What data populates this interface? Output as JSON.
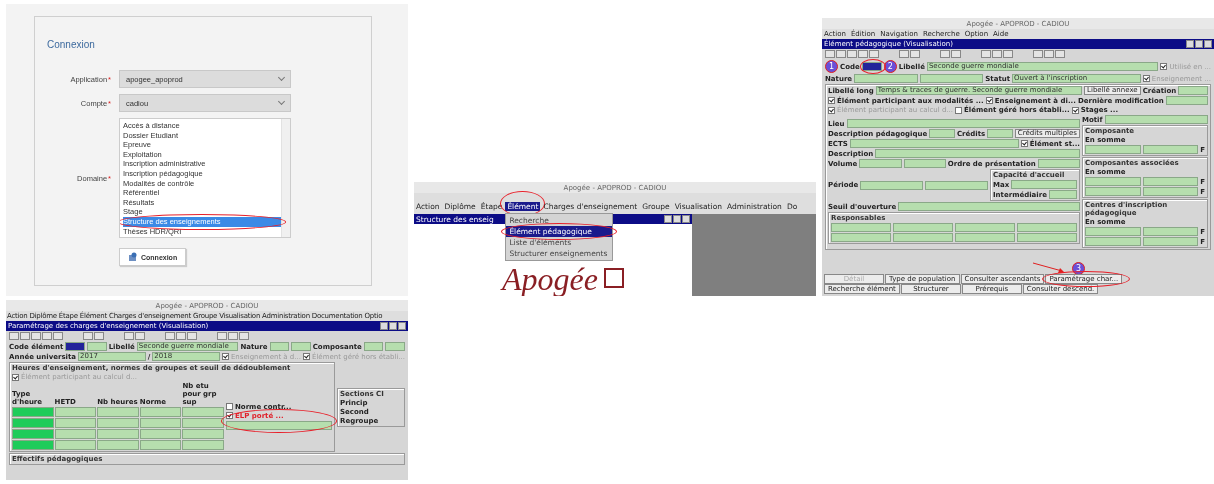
{
  "login": {
    "title": "Connexion",
    "selects": [
      {
        "label": "Application",
        "required": "*",
        "value": "apogee_apoprod"
      },
      {
        "label": "Compte",
        "required": "*",
        "value": "cadiou"
      }
    ],
    "domain": {
      "label": "Domaine",
      "required": "*",
      "options": [
        {
          "label": "Accès à distance",
          "selected": false,
          "circled": false
        },
        {
          "label": "Dossier Etudiant",
          "selected": false,
          "circled": false
        },
        {
          "label": "Epreuve",
          "selected": false,
          "circled": false
        },
        {
          "label": "Exploitation",
          "selected": false,
          "circled": false
        },
        {
          "label": "Inscription administrative",
          "selected": false,
          "circled": false
        },
        {
          "label": "Inscription pédagogique",
          "selected": false,
          "circled": false
        },
        {
          "label": "Modalités de contrôle",
          "selected": false,
          "circled": false
        },
        {
          "label": "Référentiel",
          "selected": false,
          "circled": false
        },
        {
          "label": "Résultats",
          "selected": false,
          "circled": false
        },
        {
          "label": "Stage",
          "selected": false,
          "circled": false
        },
        {
          "label": "Structure des enseignements",
          "selected": true,
          "circled": true
        },
        {
          "label": "Thèses HDR/QRI",
          "selected": false,
          "circled": false
        }
      ]
    },
    "button": "Connexion"
  },
  "menu_screen": {
    "title": "Apogée - APOPROD - CADIOU",
    "menu": [
      {
        "label": "Action",
        "open": false
      },
      {
        "label": "Diplôme",
        "open": false
      },
      {
        "label": "Étape",
        "open": false
      },
      {
        "label": "Élément",
        "open": true
      },
      {
        "label": "Charges d'enseignement",
        "open": false
      },
      {
        "label": "Groupe",
        "open": false
      },
      {
        "label": "Visualisation",
        "open": false
      },
      {
        "label": "Administration",
        "open": false
      },
      {
        "label": "Do",
        "open": false
      }
    ],
    "dropdown": [
      {
        "label": "Recherche",
        "selected": false
      },
      {
        "label": "Élément pédagogique",
        "selected": true
      },
      {
        "label": "Liste d'éléments",
        "selected": false
      },
      {
        "label": "Structurer enseignements",
        "selected": false
      }
    ],
    "child_window": "Structure des enseig",
    "logo": "Apogée"
  },
  "element_screen": {
    "title": "Apogée - APOPROD - CADIOU",
    "menu": [
      "Action",
      "Édition",
      "Navigation",
      "Recherche",
      "Option",
      "Aide"
    ],
    "window_title": "Élément pédagogique (Visualisation)",
    "rows": [
      {
        "items": [
          {
            "kind": "note",
            "text": "1"
          },
          {
            "kind": "label",
            "text": "Code"
          },
          {
            "kind": "field",
            "focused": true,
            "circled": true
          },
          {
            "kind": "note",
            "text": "2"
          },
          {
            "kind": "label",
            "text": "Libellé"
          },
          {
            "kind": "field",
            "value": "Seconde guerre mondiale"
          },
          {
            "kind": "check",
            "label": "Utilisé en ...",
            "checked": true,
            "disabled": true
          }
        ]
      },
      {
        "items": [
          {
            "kind": "label",
            "text": "Nature"
          },
          {
            "kind": "field"
          },
          {
            "kind": "field"
          },
          {
            "kind": "label",
            "text": "Statut"
          },
          {
            "kind": "field",
            "value": "Ouvert à l'inscription"
          },
          {
            "kind": "check",
            "label": "Enseignement ...",
            "checked": true,
            "disabled": true
          }
        ]
      },
      {
        "items": [
          {
            "kind": "group",
            "rows": [
              {
                "items": [
                  {
                    "kind": "label",
                    "text": "Libellé long"
                  },
                  {
                    "kind": "field",
                    "value": "Temps & traces de guerre. Seconde guerre mondiale"
                  },
                  {
                    "kind": "button",
                    "label": "Libellé annexe"
                  },
                  {
                    "kind": "label",
                    "text": "Création"
                  },
                  {
                    "kind": "field"
                  }
                ]
              },
              {
                "items": [
                  {
                    "kind": "check",
                    "label": "Élément participant aux modalités ...",
                    "checked": true
                  },
                  {
                    "kind": "check",
                    "label": "Enseignement à di...",
                    "checked": true
                  },
                  {
                    "kind": "label",
                    "text": "Dernière modification"
                  },
                  {
                    "kind": "field"
                  }
                ]
              },
              {
                "items": [
                  {
                    "kind": "check",
                    "label": "Élément participant au calcul d...",
                    "checked": true,
                    "disabled": true
                  },
                  {
                    "kind": "check",
                    "label": "Élément géré hors établi...",
                    "checked": false
                  },
                  {
                    "kind": "check",
                    "label": "Stages ...",
                    "checked": true
                  }
                ]
              },
              {
                "items": [
                  {
                    "kind": "column",
                    "rows": [
                      {
                        "items": [
                          {
                            "kind": "label",
                            "text": "Lieu"
                          },
                          {
                            "kind": "field"
                          }
                        ]
                      },
                      {
                        "items": [
                          {
                            "kind": "label",
                            "text": "Description pédagogique"
                          },
                          {
                            "kind": "field"
                          },
                          {
                            "kind": "label",
                            "text": "Crédits"
                          },
                          {
                            "kind": "field"
                          },
                          {
                            "kind": "button",
                            "label": "Crédits multiples"
                          }
                        ]
                      },
                      {
                        "items": [
                          {
                            "kind": "label",
                            "text": "ECTS"
                          },
                          {
                            "kind": "field"
                          },
                          {
                            "kind": "check",
                            "label": "Élément st...",
                            "checked": true
                          }
                        ]
                      },
                      {
                        "items": [
                          {
                            "kind": "label",
                            "text": "Description"
                          },
                          {
                            "kind": "field"
                          }
                        ]
                      },
                      {
                        "items": [
                          {
                            "kind": "label",
                            "text": "Volume"
                          },
                          {
                            "kind": "field"
                          },
                          {
                            "kind": "field"
                          },
                          {
                            "kind": "label",
                            "text": "Ordre de présentation"
                          },
                          {
                            "kind": "field"
                          }
                        ]
                      },
                      {
                        "items": [
                          {
                            "kind": "label",
                            "text": "Période"
                          },
                          {
                            "kind": "field"
                          },
                          {
                            "kind": "field"
                          },
                          {
                            "kind": "group",
                            "title": "Capacité d'accueil",
                            "rows": [
                              {
                                "items": [
                                  {
                                    "kind": "label",
                                    "text": "Max"
                                  },
                                  {
                                    "kind": "field"
                                  }
                                ]
                              },
                              {
                                "items": [
                                  {
                                    "kind": "label",
                                    "text": "Intermédiaire"
                                  },
                                  {
                                    "kind": "field"
                                  }
                                ]
                              }
                            ]
                          }
                        ]
                      },
                      {
                        "items": [
                          {
                            "kind": "label",
                            "text": "Seuil d'ouverture"
                          },
                          {
                            "kind": "field"
                          }
                        ]
                      },
                      {
                        "items": [
                          {
                            "kind": "group",
                            "title": "Responsables",
                            "rows": [
                              {
                                "items": [
                                  {
                                    "kind": "field"
                                  },
                                  {
                                    "kind": "field"
                                  },
                                  {
                                    "kind": "field"
                                  },
                                  {
                                    "kind": "field"
                                  }
                                ]
                              },
                              {
                                "items": [
                                  {
                                    "kind": "field"
                                  },
                                  {
                                    "kind": "field"
                                  },
                                  {
                                    "kind": "field"
                                  },
                                  {
                                    "kind": "field"
                                  }
                                ]
                              }
                            ]
                          }
                        ]
                      }
                    ]
                  },
                  {
                    "kind": "column",
                    "rows": [
                      {
                        "items": [
                          {
                            "kind": "label",
                            "text": "Motif"
                          },
                          {
                            "kind": "field"
                          }
                        ]
                      },
                      {
                        "items": [
                          {
                            "kind": "group",
                            "title": "Composante",
                            "rows": [
                              {
                                "items": [
                                  {
                                    "kind": "label",
                                    "text": "En somme"
                                  }
                                ]
                              },
                              {
                                "items": [
                                  {
                                    "kind": "field"
                                  },
                                  {
                                    "kind": "field"
                                  },
                                  {
                                    "kind": "label",
                                    "text": "F"
                                  }
                                ]
                              }
                            ]
                          }
                        ]
                      },
                      {
                        "items": [
                          {
                            "kind": "group",
                            "title": "Composantes associées",
                            "rows": [
                              {
                                "items": [
                                  {
                                    "kind": "label",
                                    "text": "En somme"
                                  }
                                ]
                              },
                              {
                                "items": [
                                  {
                                    "kind": "field"
                                  },
                                  {
                                    "kind": "field"
                                  },
                                  {
                                    "kind": "label",
                                    "text": "F"
                                  }
                                ]
                              },
                              {
                                "items": [
                                  {
                                    "kind": "field"
                                  },
                                  {
                                    "kind": "field"
                                  },
                                  {
                                    "kind": "label",
                                    "text": "F"
                                  }
                                ]
                              }
                            ]
                          }
                        ]
                      },
                      {
                        "items": [
                          {
                            "kind": "group",
                            "title": "Centres d'inscription pédagogique",
                            "rows": [
                              {
                                "items": [
                                  {
                                    "kind": "label",
                                    "text": "En somme"
                                  }
                                ]
                              },
                              {
                                "items": [
                                  {
                                    "kind": "field"
                                  },
                                  {
                                    "kind": "field"
                                  },
                                  {
                                    "kind": "label",
                                    "text": "F"
                                  }
                                ]
                              },
                              {
                                "items": [
                                  {
                                    "kind": "field"
                                  },
                                  {
                                    "kind": "field"
                                  },
                                  {
                                    "kind": "label",
                                    "text": "F"
                                  }
                                ]
                              }
                            ]
                          }
                        ]
                      }
                    ]
                  }
                ]
              }
            ]
          }
        ]
      }
    ],
    "buttons": [
      [
        {
          "label": "Détail",
          "disabled": true,
          "circled": false
        },
        {
          "label": "Type de population",
          "disabled": false,
          "circled": false
        },
        {
          "label": "Consulter ascendants",
          "disabled": false,
          "circled": false
        },
        {
          "label": "Paramétrage char...",
          "disabled": false,
          "circled": true
        }
      ],
      [
        {
          "label": "Recherche élément",
          "disabled": false,
          "circled": false
        },
        {
          "label": "Structurer",
          "disabled": false,
          "circled": false
        },
        {
          "label": "Prérequis",
          "disabled": false,
          "circled": false
        },
        {
          "label": "Consulter descend.",
          "disabled": false,
          "circled": false
        }
      ]
    ],
    "step": "3"
  },
  "charges_screen": {
    "title": "Apogée - APOPROD - CADIOU",
    "menu": [
      "Action",
      "Diplôme",
      "Étape",
      "Élément",
      "Charges d'enseignement",
      "Groupe",
      "Visualisation",
      "Administration",
      "Documentation",
      "Optio"
    ],
    "window_title": "Paramétrage des charges d'enseignement (Visualisation)",
    "rows": [
      {
        "items": [
          {
            "kind": "label",
            "text": "Code élément"
          },
          {
            "kind": "field",
            "focused": true
          },
          {
            "kind": "field"
          },
          {
            "kind": "label",
            "text": "Libellé"
          },
          {
            "kind": "field",
            "value": "Seconde guerre mondiale"
          },
          {
            "kind": "label",
            "text": "Nature"
          },
          {
            "kind": "field"
          },
          {
            "kind": "field"
          },
          {
            "kind": "label",
            "text": "Composante"
          },
          {
            "kind": "field"
          },
          {
            "kind": "field"
          }
        ]
      },
      {
        "items": [
          {
            "kind": "label",
            "text": "Année universita"
          },
          {
            "kind": "field",
            "value": "2017"
          },
          {
            "kind": "label",
            "text": "/"
          },
          {
            "kind": "field",
            "value": "2018"
          },
          {
            "kind": "check",
            "label": "Enseignement à d...",
            "checked": true,
            "disabled": true
          },
          {
            "kind": "check",
            "label": "Élément géré hors établi...",
            "checked": true,
            "disabled": true
          }
        ]
      },
      {
        "items": [
          {
            "kind": "group",
            "title": "Heures d'enseignement, normes de groupes et seuil de dédoublement",
            "rows": [
              {
                "items": [
                  {
                    "kind": "check",
                    "label": "Élément participant au calcul d...",
                    "checked": true,
                    "disabled": true
                  }
                ]
              },
              {
                "items": [
                  {
                    "kind": "grid",
                    "columns": [
                      "Type d'heure",
                      "HETD",
                      "Nb heures",
                      "Norme",
                      "Nb etu pour grp sup"
                    ],
                    "rows": [
                      [
                        {
                          "kind": "field"
                        },
                        {
                          "kind": "field"
                        },
                        {
                          "kind": "field"
                        },
                        {
                          "kind": "field"
                        },
                        {
                          "kind": "field"
                        }
                      ],
                      [
                        {
                          "kind": "field"
                        },
                        {
                          "kind": "field"
                        },
                        {
                          "kind": "field"
                        },
                        {
                          "kind": "field"
                        },
                        {
                          "kind": "field"
                        }
                      ],
                      [
                        {
                          "kind": "field"
                        },
                        {
                          "kind": "field"
                        },
                        {
                          "kind": "field"
                        },
                        {
                          "kind": "field"
                        },
                        {
                          "kind": "field"
                        }
                      ],
                      [
                        {
                          "kind": "field"
                        },
                        {
                          "kind": "field"
                        },
                        {
                          "kind": "field"
                        },
                        {
                          "kind": "field"
                        },
                        {
                          "kind": "field"
                        }
                      ]
                    ]
                  },
                  {
                    "kind": "column",
                    "rows": [
                      {
                        "items": [
                          {
                            "kind": "check",
                            "label": "Norme contr...",
                            "checked": false
                          }
                        ]
                      },
                      {
                        "items": [
                          {
                            "kind": "column",
                            "circled": true,
                            "rows": [
                              {
                                "items": [
                                  {
                                    "kind": "check",
                                    "label": "ELP porté ...",
                                    "checked": true,
                                    "alert": true
                                  }
                                ]
                              },
                              {
                                "items": [
                                  {
                                    "kind": "field"
                                  }
                                ]
                              }
                            ]
                          }
                        ]
                      }
                    ]
                  }
                ]
              }
            ]
          },
          {
            "kind": "group",
            "title": "Sections CI",
            "rows": [
              {
                "items": [
                  {
                    "kind": "label",
                    "text": "Princip"
                  }
                ]
              },
              {
                "items": [
                  {
                    "kind": "label",
                    "text": "Second"
                  }
                ]
              },
              {
                "items": [
                  {
                    "kind": "label",
                    "text": "Regroupe"
                  }
                ]
              }
            ]
          }
        ]
      },
      {
        "items": [
          {
            "kind": "group",
            "title": "Effectifs pédagogiques"
          }
        ]
      }
    ]
  }
}
